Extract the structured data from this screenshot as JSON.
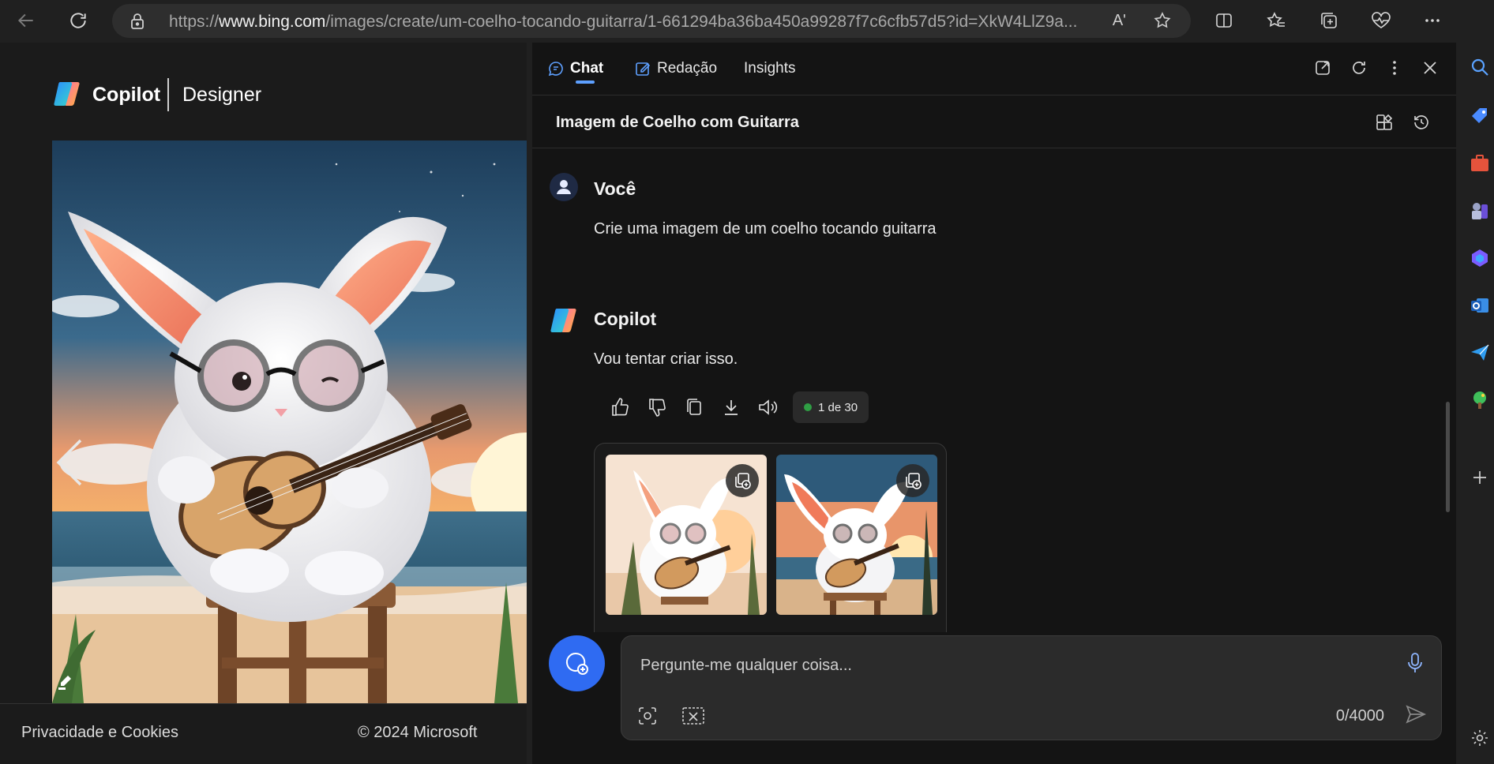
{
  "browser": {
    "url_prefix": "https://",
    "url_domain": "www.bing.com",
    "url_path": "/images/create/um-coelho-tocando-guitarra/1-661294ba36ba450a99287f7c6cfb57d5?id=XkW4LlZ9a...",
    "read_aloud": "Aʹ"
  },
  "designer": {
    "brand": "Copilot",
    "product": "Designer",
    "footer_privacy": "Privacidade e Cookies",
    "footer_copyright": "© 2024 Microsoft"
  },
  "copilot": {
    "tabs": [
      {
        "label": "Chat",
        "active": true
      },
      {
        "label": "Redação",
        "active": false
      },
      {
        "label": "Insights",
        "active": false
      }
    ],
    "conversation_title": "Imagem de Coelho com Guitarra",
    "messages": [
      {
        "author": "Você",
        "text": "Crie uma imagem de um coelho tocando guitarra"
      },
      {
        "author": "Copilot",
        "text": "Vou tentar criar isso."
      }
    ],
    "response_counter": "1 de 30",
    "composer": {
      "placeholder": "Pergunte-me qualquer coisa...",
      "char_count": "0/4000"
    }
  },
  "colors": {
    "accent": "#2f6bf2",
    "tab_underline": "#5ea0ff",
    "status_dot": "#2f9e44"
  }
}
